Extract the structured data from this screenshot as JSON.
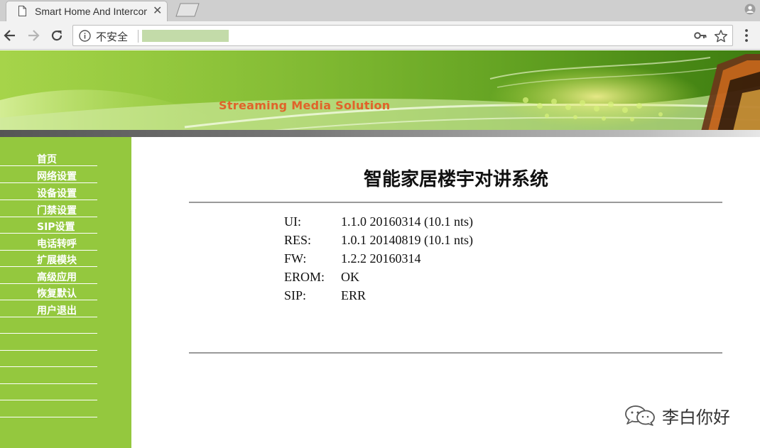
{
  "browser": {
    "tab_title": "Smart Home And Intercom",
    "tab_close": "✕",
    "security_label": "不安全",
    "icons": {
      "tab": "document-icon",
      "back": "back-arrow-icon",
      "forward": "forward-arrow-icon",
      "reload": "reload-icon",
      "info": "info-icon",
      "key": "key-icon",
      "bookmark": "star-icon",
      "menu": "kebab-menu-icon",
      "profile": "profile-icon"
    }
  },
  "banner": {
    "tagline": "Streaming Media Solution"
  },
  "sidebar": {
    "items": [
      {
        "label": "首页"
      },
      {
        "label": "网络设置"
      },
      {
        "label": "设备设置"
      },
      {
        "label": "门禁设置"
      },
      {
        "label": "SIP设置"
      },
      {
        "label": "电话转呼"
      },
      {
        "label": "扩展模块"
      },
      {
        "label": "高级应用"
      },
      {
        "label": "恢复默认"
      },
      {
        "label": "用户退出"
      }
    ]
  },
  "main": {
    "title": "智能家居楼宇对讲系统",
    "info": [
      {
        "key": "UI:",
        "value": "1.1.0 20160314 (10.1 nts)"
      },
      {
        "key": "RES:",
        "value": "1.0.1 20140819 (10.1 nts)"
      },
      {
        "key": "FW:",
        "value": "1.2.2 20160314"
      },
      {
        "key": "EROM:",
        "value": "OK"
      },
      {
        "key": "SIP:",
        "value": "ERR"
      }
    ]
  },
  "watermark": {
    "text": "李白你好"
  },
  "colors": {
    "sidebar_bg": "#94c83e",
    "banner_text": "#e0632a",
    "url_redaction": "#c3dba9"
  }
}
